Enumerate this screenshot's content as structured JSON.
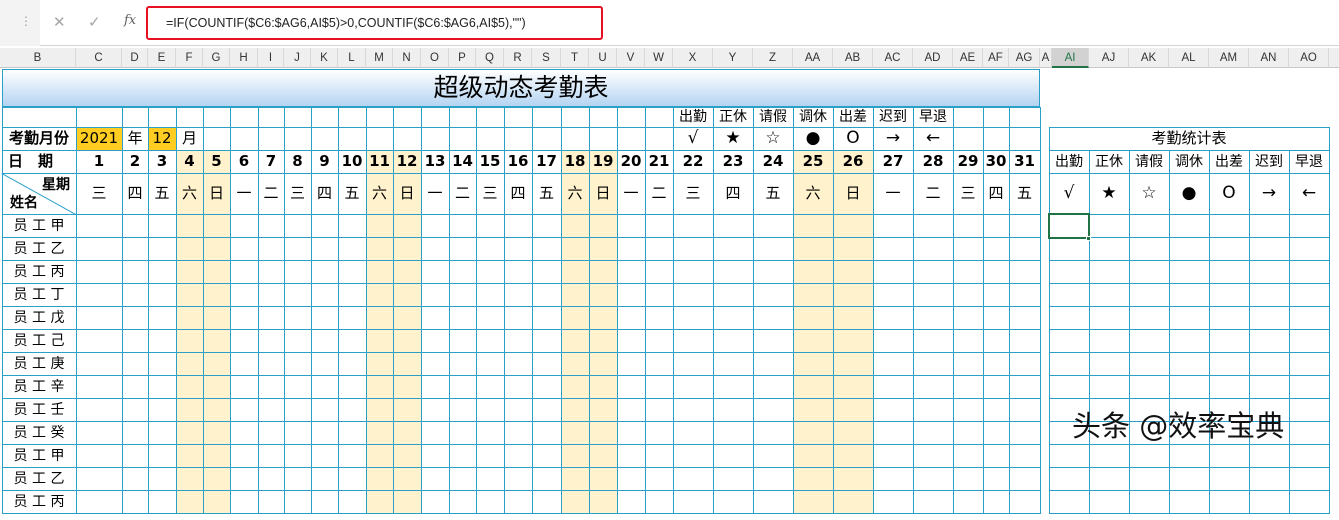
{
  "formula_bar": {
    "cancel_icon": "✕",
    "enter_icon": "✓",
    "fx_label": "fx",
    "formula": "=IF(COUNTIF($C6:$AG6,AI$5)>0,COUNTIF($C6:$AG6,AI$5),\"\")"
  },
  "column_headers": [
    "B",
    "C",
    "D",
    "E",
    "F",
    "G",
    "H",
    "I",
    "J",
    "K",
    "L",
    "M",
    "N",
    "O",
    "P",
    "Q",
    "R",
    "S",
    "T",
    "U",
    "V",
    "W",
    "X",
    "Y",
    "Z",
    "AA",
    "AB",
    "AC",
    "AD",
    "AE",
    "AF",
    "AG",
    "A",
    "AI",
    "AJ",
    "AK",
    "AL",
    "AM",
    "AN",
    "AO"
  ],
  "selected_column": "AI",
  "sheet": {
    "title": "超级动态考勤表",
    "month_label": "考勤月份",
    "year": "2021",
    "year_unit": "年",
    "month": "12",
    "month_unit": "月",
    "date_label": "日　期",
    "weekday_label": "星期",
    "name_label": "姓名",
    "legend": [
      {
        "name": "出勤",
        "symbol": "√"
      },
      {
        "name": "正休",
        "symbol": "★"
      },
      {
        "name": "请假",
        "symbol": "☆"
      },
      {
        "name": "调休",
        "symbol": "●"
      },
      {
        "name": "出差",
        "symbol": "O"
      },
      {
        "name": "迟到",
        "symbol": "→"
      },
      {
        "name": "早退",
        "symbol": "←"
      }
    ],
    "days": [
      "1",
      "2",
      "3",
      "4",
      "5",
      "6",
      "7",
      "8",
      "9",
      "10",
      "11",
      "12",
      "13",
      "14",
      "15",
      "16",
      "17",
      "18",
      "19",
      "20",
      "21",
      "22",
      "23",
      "24",
      "25",
      "26",
      "27",
      "28",
      "29",
      "30",
      "31"
    ],
    "weekdays": [
      "三",
      "四",
      "五",
      "六",
      "日",
      "一",
      "二",
      "三",
      "四",
      "五",
      "六",
      "日",
      "一",
      "二",
      "三",
      "四",
      "五",
      "六",
      "日",
      "一",
      "二",
      "三",
      "四",
      "五",
      "六",
      "日",
      "一",
      "二",
      "三",
      "四",
      "五"
    ],
    "weekend_days": [
      4,
      5,
      11,
      12,
      18,
      19,
      25,
      26
    ],
    "employees": [
      "员 工 甲",
      "员 工 乙",
      "员 工 丙",
      "员 工 丁",
      "员 工 戊",
      "员 工 己",
      "员 工 庚",
      "员 工 辛",
      "员 工 壬",
      "员 工 癸",
      "员 工 甲",
      "员 工 乙",
      "员 工 丙"
    ]
  },
  "stats": {
    "title": "考勤统计表",
    "headers": [
      "出勤",
      "正休",
      "请假",
      "调休",
      "出差",
      "迟到",
      "早退"
    ],
    "symbols": [
      "√",
      "★",
      "☆",
      "●",
      "O",
      "→",
      "←"
    ]
  },
  "watermark": "头条 @效率宝典",
  "colors": {
    "grid": "#2aa0c8",
    "year_month_fill": "#ffcc22",
    "weekend_fill": "#fff2cc",
    "selection": "#217346",
    "formula_highlight": "#e81123"
  }
}
